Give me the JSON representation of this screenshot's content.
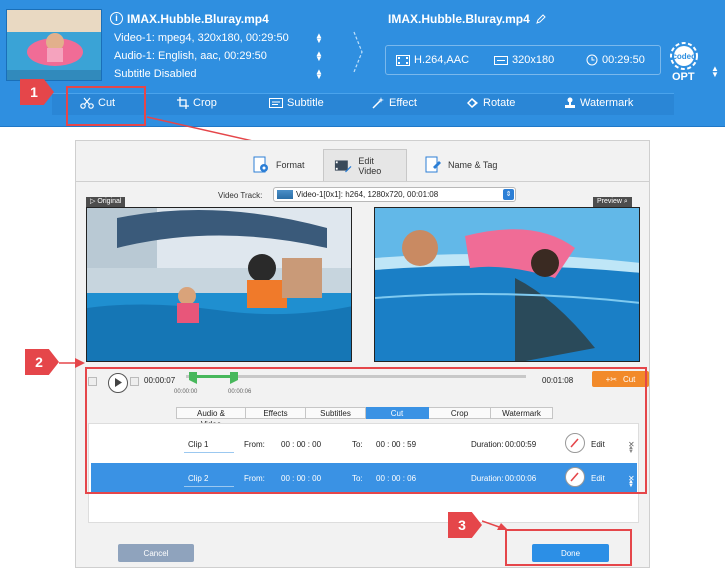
{
  "source": {
    "file_name": "IMAX.Hubble.Bluray.mp4",
    "video_track": "Video-1: mpeg4, 320x180, 00:29:50",
    "audio_track": "Audio-1: English, aac, 00:29:50",
    "subtitle": "Subtitle Disabled"
  },
  "output": {
    "file_name": "IMAX.Hubble.Bluray.mp4",
    "codec": "H.264,AAC",
    "resolution": "320x180",
    "duration": "00:29:50",
    "codec_badge": "codec",
    "opt_label": "OPT"
  },
  "toolbar": {
    "items": [
      {
        "label": "Cut",
        "icon": "scissors-icon"
      },
      {
        "label": "Crop",
        "icon": "crop-icon"
      },
      {
        "label": "Subtitle",
        "icon": "subtitle-icon"
      },
      {
        "label": "Effect",
        "icon": "effect-wand-icon"
      },
      {
        "label": "Rotate",
        "icon": "rotate-icon"
      },
      {
        "label": "Watermark",
        "icon": "watermark-stamp-icon"
      }
    ]
  },
  "callouts": {
    "step1": "1",
    "step2": "2",
    "step3": "3",
    "color": "#e5464a"
  },
  "dialog": {
    "tabs": [
      {
        "label": "Format",
        "icon": "format-settings-icon"
      },
      {
        "label": "Edit Video",
        "icon": "edit-video-icon"
      },
      {
        "label": "Name & Tag",
        "icon": "name-tag-icon"
      }
    ],
    "active_tab": "Edit Video",
    "video_track_label": "Video Track:",
    "video_track_value": "Video-1[0x1]: h264, 1280x720, 00:01:08",
    "original_label": "Original",
    "preview_label": "Preview",
    "timeline": {
      "current_time": "00:00:07",
      "end_time": "00:01:08",
      "marker_start": "00:00:00",
      "marker_end": "00:00:06",
      "cut_button": "Cut"
    },
    "subtabs": [
      "Audio & Video",
      "Effects",
      "Subtitles",
      "Cut",
      "Crop",
      "Watermark"
    ],
    "active_subtab": "Cut",
    "clips": [
      {
        "name": "Clip 1",
        "from_label": "From:",
        "from": "00 : 00 : 00",
        "to_label": "To:",
        "to": "00 : 00 : 59",
        "duration_label": "Duration:",
        "duration": "00:00:59",
        "edit": "Edit"
      },
      {
        "name": "Clip 2",
        "from_label": "From:",
        "from": "00 : 00 : 00",
        "to_label": "To:",
        "to": "00 : 00 : 06",
        "duration_label": "Duration:",
        "duration": "00:00:06",
        "edit": "Edit"
      }
    ],
    "cancel_button": "Cancel",
    "done_button": "Done"
  },
  "colors": {
    "panel_blue": "#2f8fe0",
    "accent_blue": "#3a92e4",
    "cut_orange": "#f28a2a",
    "highlight_red": "#e5464a"
  }
}
